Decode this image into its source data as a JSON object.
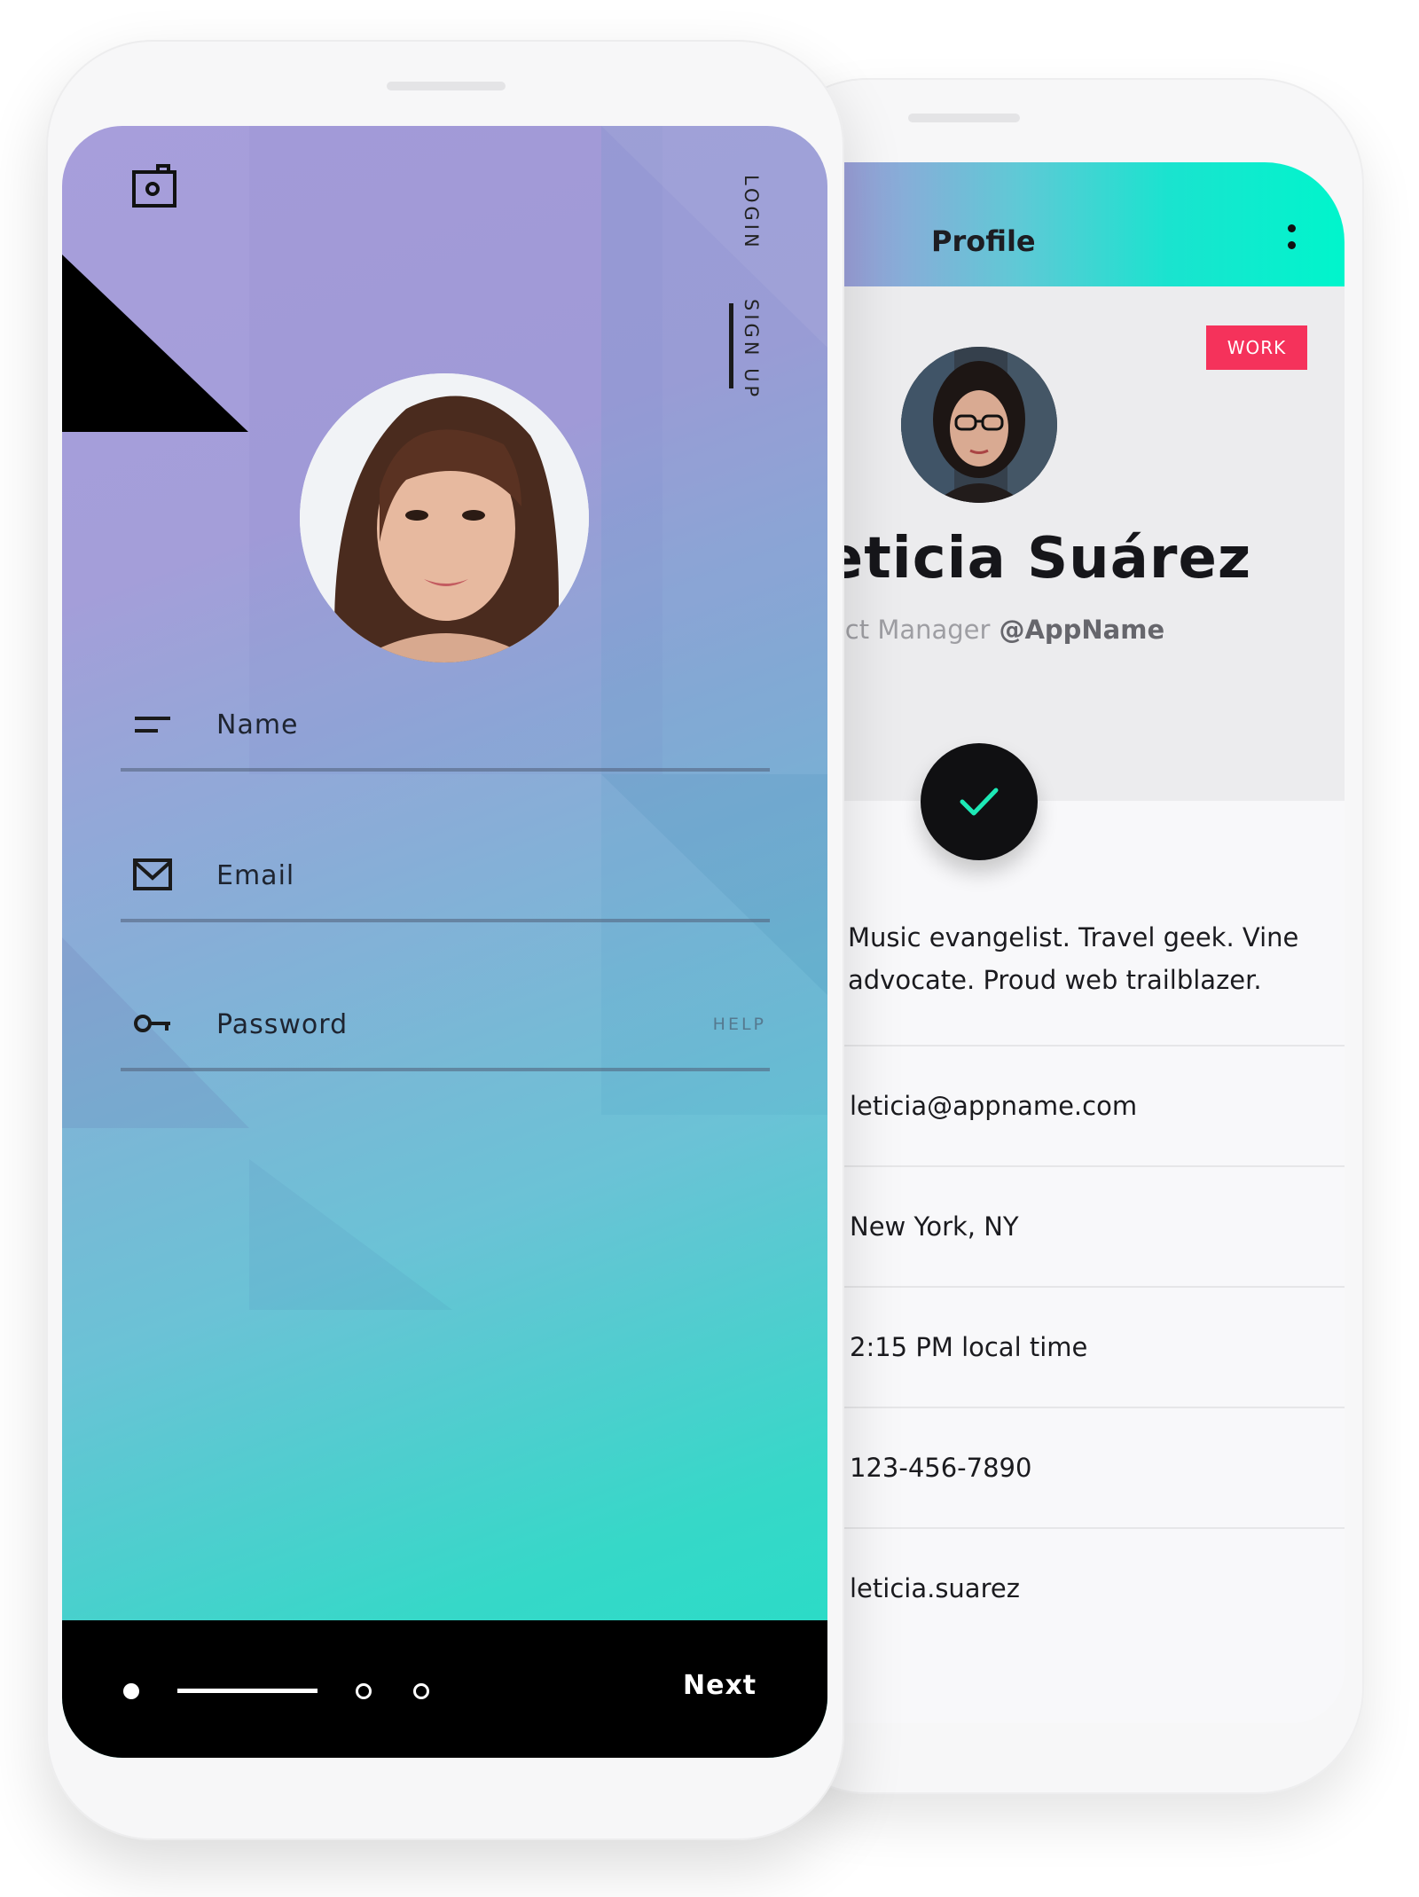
{
  "login": {
    "tabs": {
      "login": "LOGIN",
      "signup": "SIGN UP",
      "active": "signup"
    },
    "fields": [
      {
        "label": "Name",
        "icon": "short-text-icon"
      },
      {
        "label": "Email",
        "icon": "envelope-icon"
      },
      {
        "label": "Password",
        "icon": "key-icon"
      }
    ],
    "help_label": "HELP",
    "next_label": "Next",
    "pager": {
      "pages": 4,
      "current": 1
    },
    "icons": {
      "top_left": "camera-icon"
    },
    "colors": {
      "gradient_start": "#a79edb",
      "gradient_end": "#22dec6",
      "bottom_bar": "#000000"
    }
  },
  "profile": {
    "title": "Profile",
    "badge": "WORK",
    "name": "Leticia Suárez",
    "role": "Product Manager",
    "handle": "@AppName",
    "bio": "Music evangelist. Travel geek. Vine advocate. Proud web trailblazer.",
    "details": [
      "leticia@appname.com",
      "New York, NY",
      "2:15 PM local time",
      "123-456-7890",
      "leticia.suarez"
    ],
    "icons": {
      "menu": "more-vertical-icon",
      "action": "check-icon"
    },
    "colors": {
      "badge": "#f5325b",
      "header_end": "#00f5cc",
      "check": "#1de9b6"
    }
  }
}
